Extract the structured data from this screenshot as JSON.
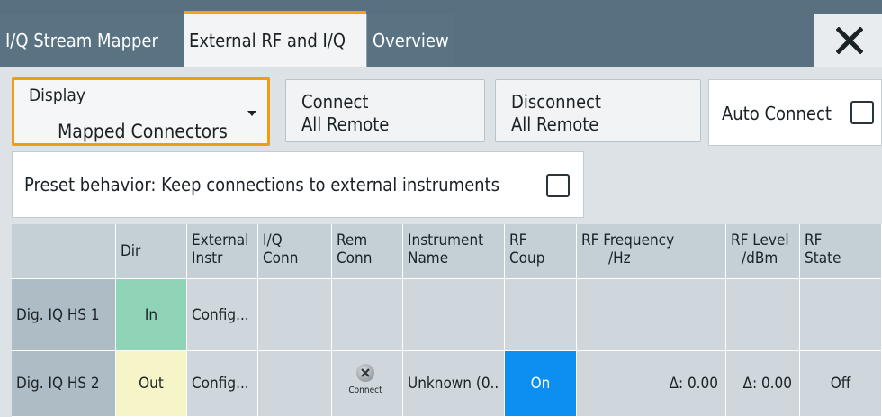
{
  "tabs": [
    {
      "label": "I/Q Stream Mapper",
      "active": false
    },
    {
      "label": "External RF and I/Q",
      "active": true
    },
    {
      "label": "Overview",
      "active": false
    }
  ],
  "close_icon": "close-icon",
  "controls": {
    "display": {
      "label": "Display",
      "value": "Mapped Connectors"
    },
    "connect_button": {
      "line1": "Connect",
      "line2": "All Remote"
    },
    "disconnect_button": {
      "line1": "Disconnect",
      "line2": "All Remote"
    },
    "auto_connect": {
      "label": "Auto Connect",
      "checked": false
    },
    "preset": {
      "label": "Preset behavior: Keep connections to external instruments",
      "checked": false
    }
  },
  "table": {
    "headers": [
      {
        "l1": "",
        "l2": ""
      },
      {
        "l1": "Dir",
        "l2": ""
      },
      {
        "l1": "External",
        "l2": "Instr"
      },
      {
        "l1": "I/Q",
        "l2": "Conn"
      },
      {
        "l1": "Rem",
        "l2": "Conn"
      },
      {
        "l1": "Instrument",
        "l2": "Name"
      },
      {
        "l1": "RF",
        "l2": "Coup"
      },
      {
        "l1": "RF Frequency",
        "l2": "/Hz"
      },
      {
        "l1": "RF Level",
        "l2": "/dBm"
      },
      {
        "l1": "RF",
        "l2": "State"
      }
    ],
    "rows": [
      {
        "name": "Dig. IQ HS 1",
        "dir": "In",
        "ext_instr": "Config...",
        "iq_conn": "",
        "rem_conn": "",
        "instrument_name": "",
        "rf_coup": "",
        "rf_freq": "",
        "rf_level": "",
        "rf_state": ""
      },
      {
        "name": "Dig. IQ HS 2",
        "dir": "Out",
        "ext_instr": "Config...",
        "iq_conn": "",
        "rem_conn": "Connect",
        "instrument_name": "Unknown (0..",
        "rf_coup": "On",
        "rf_freq": "Δ: 0.00",
        "rf_level": "Δ: 0.00",
        "rf_state": "Off"
      }
    ]
  },
  "colors": {
    "tabbar": "#58707f",
    "active_tab_accent": "#f6a11c",
    "dir_in": "#8fd4b6",
    "dir_out": "#f6f5c7",
    "rf_coup_on": "#0c8ff0",
    "focus_border": "#f39c12"
  }
}
